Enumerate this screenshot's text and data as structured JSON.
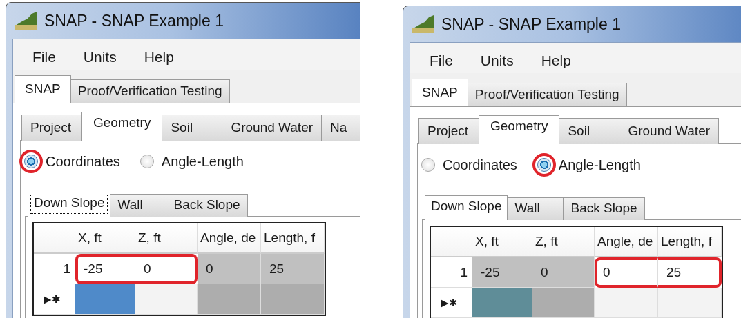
{
  "windows": [
    {
      "title": "SNAP - SNAP Example 1",
      "menu": [
        "File",
        "Units",
        "Help"
      ],
      "main_tabs": [
        {
          "label": "SNAP",
          "selected": true
        },
        {
          "label": "Proof/Verification Testing",
          "selected": false
        }
      ],
      "section_tabs": [
        {
          "label": "Project",
          "selected": false
        },
        {
          "label": "Geometry",
          "selected": true
        },
        {
          "label": "Soil",
          "selected": false
        },
        {
          "label": "Ground Water",
          "selected": false
        },
        {
          "label": "Na",
          "selected": false
        }
      ],
      "layout_options": [
        {
          "label": "Coordinates",
          "selected": true,
          "highlighted": true
        },
        {
          "label": "Angle-Length",
          "selected": false,
          "highlighted": false
        }
      ],
      "slope_tabs": [
        {
          "label": "Down Slope",
          "selected": true,
          "focused": true
        },
        {
          "label": "Wall",
          "selected": false,
          "focused": false
        },
        {
          "label": "Back Slope",
          "selected": false,
          "focused": false
        }
      ],
      "grid": {
        "columns": [
          "X, ft",
          "Z, ft",
          "Angle, de",
          "Length, f"
        ],
        "rows": [
          {
            "header": "1",
            "new": false,
            "cells": [
              {
                "value": "-25",
                "disabled": false,
                "selected": false,
                "highlighted": true
              },
              {
                "value": "0",
                "disabled": false,
                "selected": false,
                "highlighted": true
              },
              {
                "value": "0",
                "disabled": true,
                "selected": false,
                "highlighted": false
              },
              {
                "value": "25",
                "disabled": true,
                "selected": false,
                "highlighted": false
              }
            ]
          },
          {
            "header": "▶✱",
            "new": true,
            "cells": [
              {
                "disabled": false,
                "selected": true,
                "highlighted": false
              },
              {
                "disabled": false,
                "selected": false,
                "highlighted": false
              },
              {
                "disabled": true,
                "selected": false,
                "highlighted": false
              },
              {
                "disabled": true,
                "selected": false,
                "highlighted": false
              }
            ]
          }
        ]
      }
    },
    {
      "title": "SNAP - SNAP Example 1",
      "menu": [
        "File",
        "Units",
        "Help"
      ],
      "main_tabs": [
        {
          "label": "SNAP",
          "selected": true
        },
        {
          "label": "Proof/Verification Testing",
          "selected": false
        }
      ],
      "section_tabs": [
        {
          "label": "Project",
          "selected": false
        },
        {
          "label": "Geometry",
          "selected": true
        },
        {
          "label": "Soil",
          "selected": false
        },
        {
          "label": "Ground Water",
          "selected": false
        }
      ],
      "layout_options": [
        {
          "label": "Coordinates",
          "selected": false,
          "highlighted": false
        },
        {
          "label": "Angle-Length",
          "selected": true,
          "highlighted": true
        }
      ],
      "slope_tabs": [
        {
          "label": "Down Slope",
          "selected": true,
          "focused": false
        },
        {
          "label": "Wall",
          "selected": false,
          "focused": false
        },
        {
          "label": "Back Slope",
          "selected": false,
          "focused": false
        }
      ],
      "grid": {
        "columns": [
          "X, ft",
          "Z, ft",
          "Angle, de",
          "Length, f"
        ],
        "rows": [
          {
            "header": "1",
            "new": false,
            "cells": [
              {
                "value": "-25",
                "disabled": true,
                "selected": false,
                "highlighted": false
              },
              {
                "value": "0",
                "disabled": true,
                "selected": false,
                "highlighted": false
              },
              {
                "value": "0",
                "disabled": false,
                "selected": false,
                "highlighted": true
              },
              {
                "value": "25",
                "disabled": false,
                "selected": false,
                "highlighted": true
              }
            ]
          },
          {
            "header": "▶✱",
            "new": true,
            "cells": [
              {
                "disabled": true,
                "selected": true,
                "highlighted": false
              },
              {
                "disabled": true,
                "selected": false,
                "highlighted": false
              },
              {
                "disabled": false,
                "selected": false,
                "highlighted": false
              },
              {
                "disabled": false,
                "selected": false,
                "highlighted": false
              }
            ]
          }
        ]
      }
    }
  ]
}
